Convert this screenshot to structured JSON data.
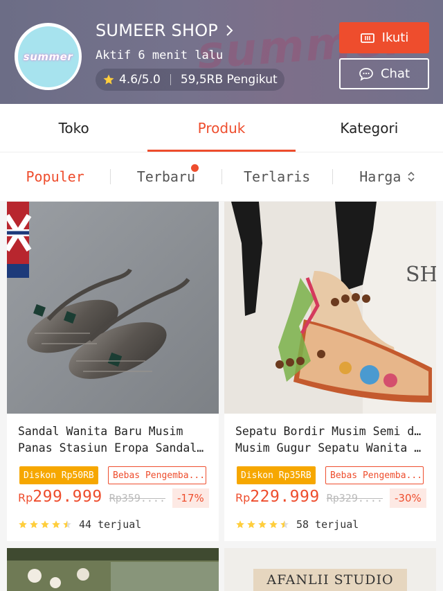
{
  "shop": {
    "avatar_text": "summer",
    "banner_text": "summer",
    "name": "SUMEER SHOP",
    "active_status": "Aktif 6 menit lalu",
    "rating": "4.6/5.0",
    "followers": "59,5RB Pengikut",
    "follow_label": "Ikuti",
    "chat_label": "Chat"
  },
  "tabs": [
    {
      "label": "Toko"
    },
    {
      "label": "Produk"
    },
    {
      "label": "Kategori"
    }
  ],
  "sort": [
    {
      "label": "Populer"
    },
    {
      "label": "Terbaru"
    },
    {
      "label": "Terlaris"
    },
    {
      "label": "Harga"
    }
  ],
  "products": [
    {
      "title_line1": "Sandal Wanita Baru Musim",
      "title_line2": "Panas Stasiun Eropa Sandal Ka...",
      "discount_badge": "Diskon Rp50RB",
      "shipping_badge": "Bebas Pengemba...",
      "currency": "Rp",
      "price": "299.999",
      "old_price": "Rp359....",
      "discount_pct": "-17%",
      "rating_stars": 4.5,
      "sold": "44 terjual"
    },
    {
      "title_line1": "Sepatu Bordir Musim Semi dan",
      "title_line2": "Musim Gugur Sepatu Wanita G...",
      "discount_badge": "Diskon Rp35RB",
      "shipping_badge": "Bebas Pengemba...",
      "currency": "Rp",
      "price": "229.999",
      "old_price": "Rp329....",
      "discount_pct": "-30%",
      "rating_stars": 4.5,
      "sold": "58 terjual"
    }
  ],
  "next_row": {
    "studio_sign": "AFANLII STUDIO"
  },
  "colors": {
    "accent": "#ee4d2d",
    "discount_badge": "#f6a700",
    "star": "#ffce3d"
  }
}
